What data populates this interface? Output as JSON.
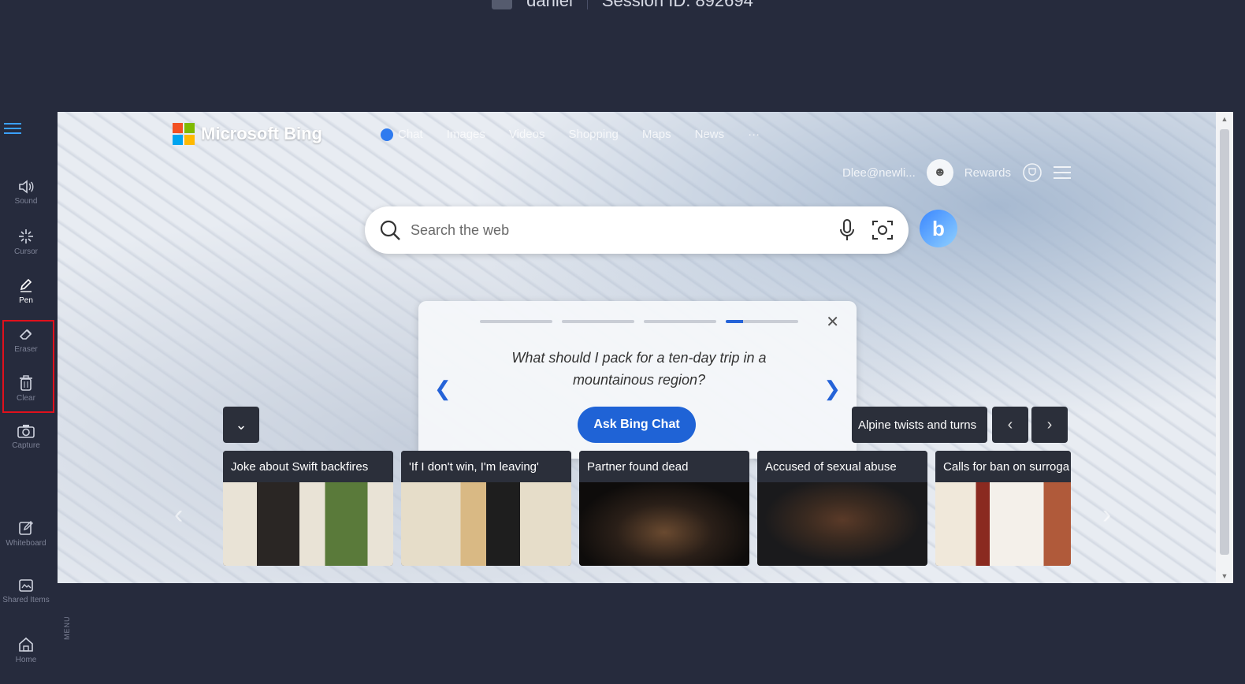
{
  "session": {
    "user": "daniel",
    "session_label": "Session ID: 892694"
  },
  "toolbar": {
    "sound": "Sound",
    "cursor": "Cursor",
    "pen": "Pen",
    "eraser": "Eraser",
    "clear": "Clear",
    "capture": "Capture",
    "whiteboard": "Whiteboard",
    "shared_items": "Shared Items",
    "home": "Home",
    "menu": "MENU"
  },
  "bing": {
    "brand": "Microsoft Bing",
    "nav": [
      "Chat",
      "Images",
      "Videos",
      "Shopping",
      "Maps",
      "News",
      "···"
    ],
    "user_email": "Dlee@newli...",
    "rewards": "Rewards",
    "search_placeholder": "Search the web",
    "prompt": {
      "question": "What should I pack for a ten-day trip in a mountainous region?",
      "button": "Ask Bing Chat",
      "close": "✕"
    },
    "topic": "Alpine twists and turns",
    "news": [
      {
        "title": "Joke about Swift backfires"
      },
      {
        "title": "'If I don't win, I'm leaving'"
      },
      {
        "title": "Partner found dead"
      },
      {
        "title": "Accused of sexual abuse"
      },
      {
        "title": "Calls for ban on surroga"
      }
    ]
  },
  "colors": {
    "accent": "#1f63d6",
    "highlight": "#e0101c",
    "bg": "#262b3d"
  }
}
